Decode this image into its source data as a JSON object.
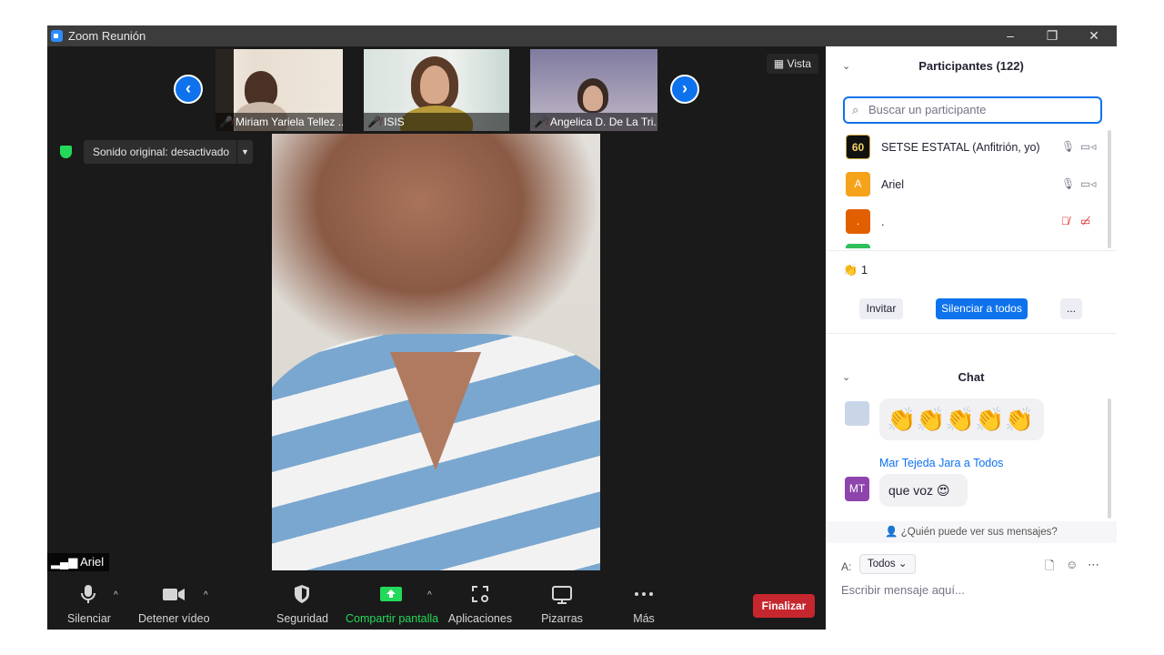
{
  "window": {
    "title": "Zoom Reunión",
    "controls": [
      "–",
      "❐",
      "✕"
    ]
  },
  "thumbnails": [
    {
      "name": "Miriam Yariela Tellez ...",
      "muted": true
    },
    {
      "name": "ISIS",
      "muted": true
    },
    {
      "name": "Angelica D. De La Tri...",
      "muted": true
    }
  ],
  "vista_label": "Vista",
  "sound_label": "Sonido original: desactivado",
  "active_speaker": "Ariel",
  "toolbar": {
    "mute": "Silenciar",
    "video": "Detener vídeo",
    "security": "Seguridad",
    "share": "Compartir pantalla",
    "apps": "Aplicaciones",
    "whiteboards": "Pizarras",
    "more": "Más",
    "end": "Finalizar"
  },
  "participants": {
    "header": "Participantes (122)",
    "search_placeholder": "Buscar un participante",
    "list": [
      {
        "avatar": "60",
        "name": "SETSE ESTATAL (Anfitrión, yo)",
        "avatar_color": "#111111",
        "muted": false
      },
      {
        "avatar": "A",
        "name": "Ariel",
        "avatar_color": "#f5a31a",
        "muted": false
      },
      {
        "avatar": ".",
        "name": ".",
        "avatar_color": "#e25f00",
        "muted": true
      }
    ],
    "reaction_count": "1",
    "invite": "Invitar",
    "mute_all": "Silenciar a todos",
    "more": "..."
  },
  "chat": {
    "header": "Chat",
    "messages": [
      {
        "sender": "",
        "text": "👏👏👏👏👏"
      },
      {
        "sender": "Mar Tejeda Jara a Todos",
        "avatar": "MT",
        "avatar_color": "#8e44ad",
        "text": "que voz 😍"
      }
    ],
    "who_sees": "¿Quién puede ver sus mensajes?",
    "to_label": "A:",
    "to_value": "Todos",
    "input_placeholder": "Escribir mensaje aquí..."
  }
}
